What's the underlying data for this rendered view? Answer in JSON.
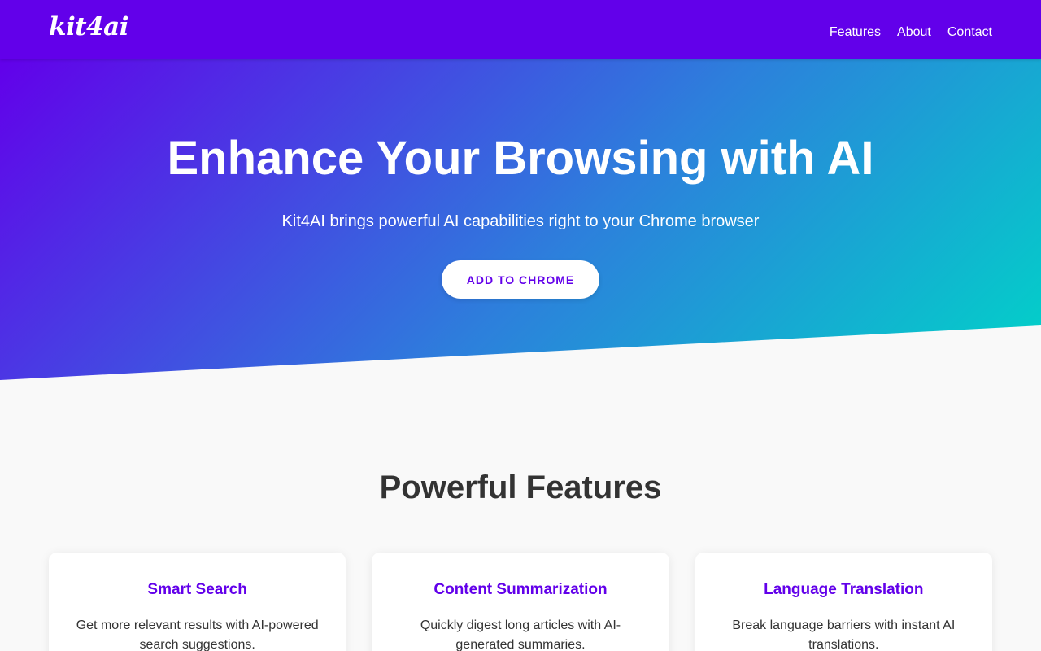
{
  "navbar": {
    "logo": "kit4ai",
    "links": [
      "Features",
      "About",
      "Contact"
    ]
  },
  "hero": {
    "title": "Enhance Your Browsing with AI",
    "subtitle": "Kit4AI brings powerful AI capabilities right to your Chrome browser",
    "cta_label": "ADD TO CHROME"
  },
  "features": {
    "title": "Powerful Features",
    "cards": [
      {
        "title": "Smart Search",
        "desc": "Get more relevant results with AI-powered search suggestions."
      },
      {
        "title": "Content Summarization",
        "desc": "Quickly digest long articles with AI-generated summaries."
      },
      {
        "title": "Language Translation",
        "desc": "Break language barriers with instant AI translations."
      }
    ]
  },
  "colors": {
    "brand": "#6200ea",
    "gradient_end": "#00d4c8",
    "background": "#f9f9f9"
  }
}
